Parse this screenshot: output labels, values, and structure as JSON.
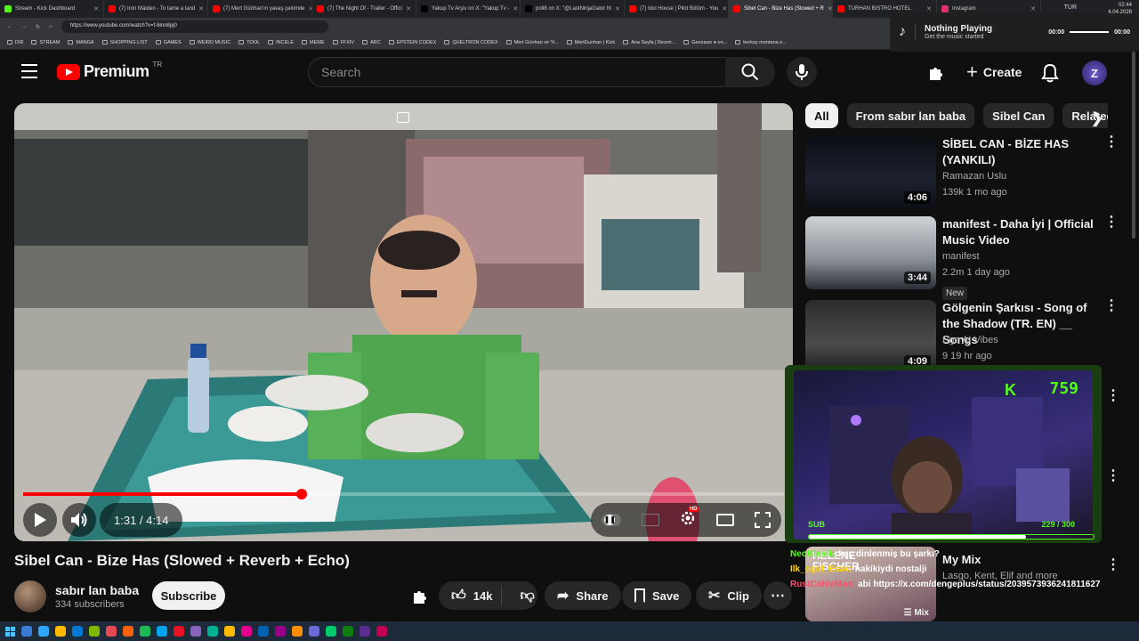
{
  "browser": {
    "tabs": [
      {
        "label": "Stream - Kick Dashboard",
        "color": "#53fc18"
      },
      {
        "label": "(7) Iron Maiden - To tame a land",
        "color": "#ff0000"
      },
      {
        "label": "(7) Mert Günhan'ın yavaş çekimde",
        "color": "#ff0000"
      },
      {
        "label": "(7) The Night Of - Trailer - Offici",
        "color": "#ff0000"
      },
      {
        "label": "Yakup Tv Arşiv on X: \"Yakup Tv -",
        "color": "#000000"
      },
      {
        "label": "poll8 on X: \"@LastNinjaGator ht",
        "color": "#000000"
      },
      {
        "label": "(7) Idol House | Pilot Bölüm - You",
        "color": "#ff0000"
      },
      {
        "label": "Sibel Can - Bize Has (Slowed + R",
        "color": "#ff0000"
      },
      {
        "label": "TURHAN BISTRO HOTEL",
        "color": "#ff0000"
      },
      {
        "label": "Instagram",
        "color": "#e1306c"
      }
    ],
    "url": "https://www.youtube.com/watch?v=f-8inn8pj0",
    "bookmarks": [
      "DIR",
      "STREAM",
      "MANGA",
      "SHOPPING LIST",
      "GAMES",
      "WEIRD MUSIC",
      "TOOL",
      "INCELE",
      "MEME",
      "FFXIV",
      "ARC",
      "EPSTEIN CODEX",
      "QUELTRON CODEX",
      "Mert Günhan ve Yi...",
      "MertGunhan | Kick",
      "Ana Sayfa | Resmi...",
      "Geezaws ● on...",
      "berkay montana o..."
    ]
  },
  "media_widget": {
    "title": "Nothing Playing",
    "subtitle": "Get the music started",
    "time_start": "00:00",
    "time_end": "00:00"
  },
  "header": {
    "logo_text": "Premium",
    "country_code": "TR",
    "search_placeholder": "Search",
    "create_label": "Create",
    "avatar_initial": "Z"
  },
  "player": {
    "time_display": "1:31 / 4:14",
    "progress_fraction": 0.366,
    "hd_badge": "HD"
  },
  "video": {
    "title": "Sibel Can - Bize Has (Slowed + Reverb + Echo)",
    "channel_name": "sabır lan baba",
    "subscribers": "334 subscribers",
    "subscribe_label": "Subscribe",
    "likes": "14k",
    "share_label": "Share",
    "save_label": "Save",
    "clip_label": "Clip"
  },
  "sidebar": {
    "chips": [
      "All",
      "From sabır lan baba",
      "Sibel Can",
      "Related"
    ],
    "recommendations": [
      {
        "title": "SİBEL CAN - BİZE HAS (YANKILI)",
        "channel": "Ramazan Uslu",
        "stats": "139k  1 mo ago",
        "duration": "4:06",
        "new": ""
      },
      {
        "title": "manifest - Daha İyi | Official Music Video",
        "channel": "manifest",
        "stats": "2.2m  1 day ago",
        "duration": "3:44",
        "new": "New"
      },
      {
        "title": "Gölgenin Şarkısı - Song of the Shadow (TR. EN) __ Songs",
        "channel": "Ege AI Vibes",
        "stats": "9  19 hr ago",
        "duration": "4:09",
        "new": ""
      }
    ],
    "mix": {
      "title": "My Mix",
      "subtitle": "Lasgo, Kent, Elif and more",
      "thumb_label": "Mix",
      "thumb_text": "HELENE FISCHER"
    }
  },
  "stream_overlay": {
    "viewer_count": "759",
    "sub_label": "SUB",
    "sub_count": "229 / 300",
    "sub_fraction": 0.763,
    "accent": "#53fc18"
  },
  "chat": [
    {
      "user": "NeoKlasik:",
      "message": " kaç dinlenmiş bu şarkı?",
      "color": "#53fc18"
    },
    {
      "user": "Ilk_ogul_Esav:",
      "message": " hakikiydi nostalji",
      "color": "#ffd400"
    },
    {
      "user": "RustCohleMan:",
      "message": " abi https://x.com/dengeplus/status/2039573936241811627",
      "color": "#ff4d6d"
    }
  ],
  "taskbar": {
    "lang": "TUR",
    "time": "02:44",
    "date": "4.04.2026"
  }
}
